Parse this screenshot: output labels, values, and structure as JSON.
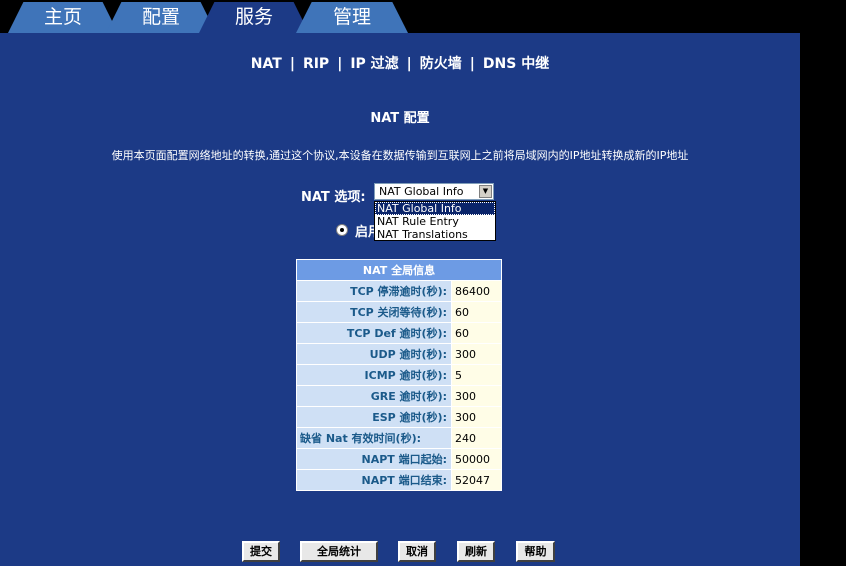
{
  "tabs": [
    {
      "label": "主页"
    },
    {
      "label": "配置"
    },
    {
      "label": "服务"
    },
    {
      "label": "管理"
    }
  ],
  "subnav": {
    "nat": "NAT",
    "rip": "RIP",
    "ip_filter": "IP 过滤",
    "firewall": "防火墙",
    "dns_relay": "DNS 中继",
    "separator": "|"
  },
  "page": {
    "title": "NAT 配置",
    "description": "使用本页面配置网络地址的转换,通过这个协议,本设备在数据传输到互联网上之前将局域网内的IP地址转换成新的IP地址"
  },
  "nat_option": {
    "label": "NAT 选项:",
    "selected": "NAT Global Info",
    "options": [
      "NAT Global Info",
      "NAT Rule Entry",
      "NAT Translations"
    ]
  },
  "enable_radio": {
    "label": "启用",
    "checked": true
  },
  "global_table": {
    "header": "NAT 全局信息",
    "rows": [
      {
        "label": "TCP 停滞逾时(秒):",
        "value": "86400"
      },
      {
        "label": "TCP 关闭等待(秒):",
        "value": "60"
      },
      {
        "label": "TCP Def 逾时(秒):",
        "value": "60"
      },
      {
        "label": "UDP 逾时(秒):",
        "value": "300"
      },
      {
        "label": "ICMP 逾时(秒):",
        "value": "5"
      },
      {
        "label": "GRE 逾时(秒):",
        "value": "300"
      },
      {
        "label": "ESP 逾时(秒):",
        "value": "300"
      },
      {
        "label": "缺省 Nat 有效时间(秒):",
        "value": "240"
      },
      {
        "label": "NAPT 端口起始:",
        "value": "50000"
      },
      {
        "label": "NAPT 端口结束:",
        "value": "52047"
      }
    ]
  },
  "buttons": {
    "submit": "提交",
    "global_stats": "全局统计",
    "cancel": "取消",
    "refresh": "刷新",
    "help": "帮助"
  },
  "colors": {
    "panel": "#1c3a86",
    "tab": "#3f74b9",
    "table_header": "#6d9be4",
    "label_cell": "#cfe0f5",
    "value_cell": "#fffde7"
  }
}
